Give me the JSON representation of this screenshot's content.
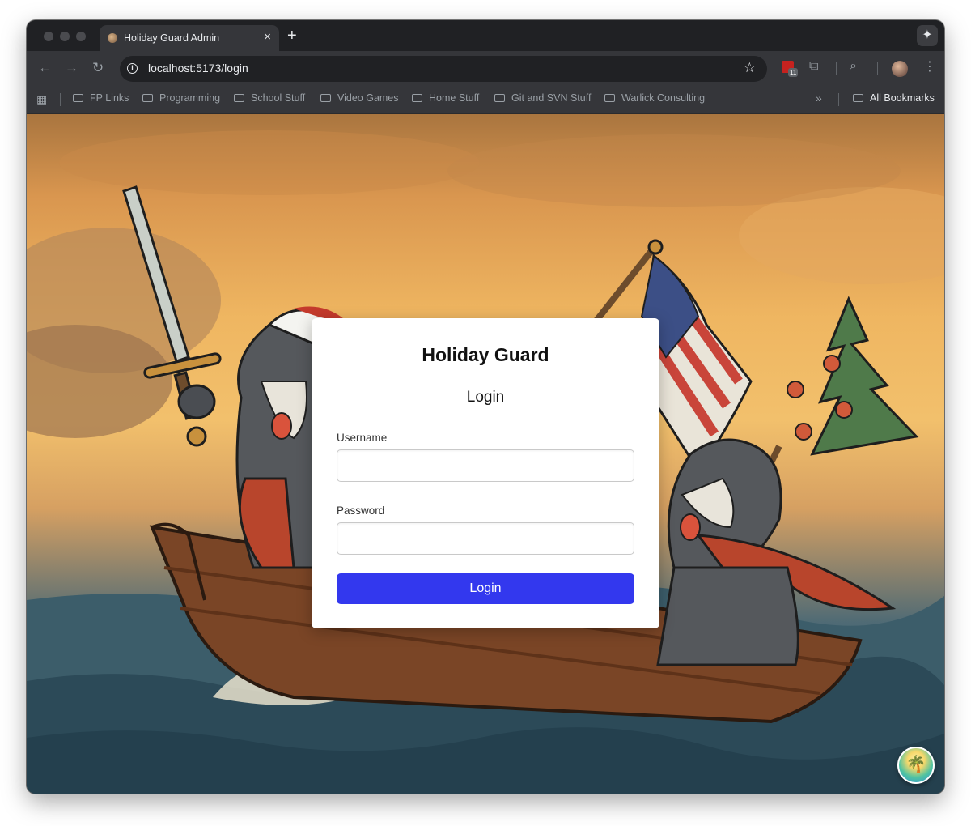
{
  "browser": {
    "tab_title": "Holiday Guard Admin",
    "tab_close_glyph": "×",
    "new_tab_glyph": "+",
    "url": "localhost:5173/login",
    "extension_badge": "11",
    "bookmarks": [
      "FP Links",
      "Programming",
      "School Stuff",
      "Video Games",
      "Home Stuff",
      "Git and SVN Stuff",
      "Warlick Consulting"
    ],
    "all_bookmarks_label": "All Bookmarks",
    "icons": [
      "back-icon",
      "forward-icon",
      "reload-icon",
      "site-info-icon",
      "bookmark-star-icon",
      "extensions-icon",
      "tab-search-icon",
      "profile-avatar",
      "menu-icon",
      "apps-grid-icon",
      "folder-icon",
      "gemini-icon"
    ]
  },
  "login": {
    "title": "Holiday Guard",
    "subtitle": "Login",
    "username_label": "Username",
    "username_value": "",
    "password_label": "Password",
    "password_value": "",
    "submit_label": "Login"
  },
  "colors": {
    "primary_button": "#3338ee",
    "browser_frame": "#202124",
    "toolbar": "#35363a",
    "card_background": "#ffffff"
  },
  "background_image": "Illustration of two schnauzer dogs in Santa hats rowing a wooden boat on stormy sea, one holding a sword, one holding an American flag and a Christmas tree, golden sky"
}
